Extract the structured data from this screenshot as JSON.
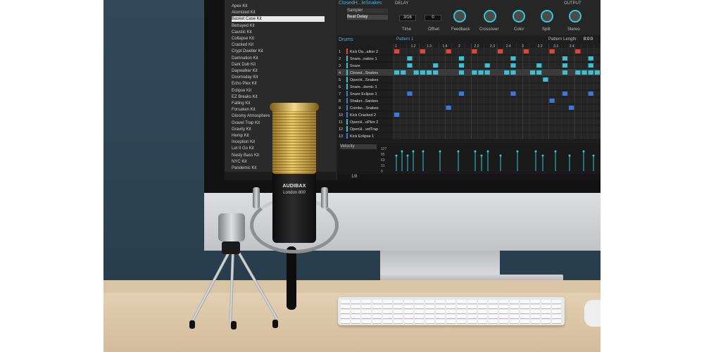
{
  "library": {
    "kits": [
      "Apex Kit",
      "Atomized Kit",
      "Basket Case Kit",
      "Betrayed Kit",
      "Caustic Kit",
      "Collapse Kit",
      "Cracked Kit",
      "Crypt Dweller Kit",
      "Damnation Kit",
      "Dark Dub Kit",
      "Daywalker Kit",
      "Doomsday Kit",
      "Echo Plex Kit",
      "Eclipse Kit",
      "EZ Breaks Kit",
      "Falling Kit",
      "Forsaken Kit",
      "Gloomy Atmosphere",
      "Gravel Trap Kit",
      "Gravity Kit",
      "Hemp Kit",
      "Inception Kit",
      "Let It Go Kit",
      "Nasty Bass Kit",
      "NYC Kit",
      "Pandemic Kit"
    ],
    "selected_index": 2
  },
  "plugin": {
    "sound_name": "ClosedH...leSnakes",
    "slots": [
      "Sampler",
      "Beat Delay"
    ],
    "section": "DELAY",
    "output_label": "OUTPUT",
    "time_value": "3/16",
    "offset_value": "0",
    "knobs": [
      "Time",
      "Offset",
      "Feedback",
      "Crossover",
      "Color",
      "Split",
      "Stereo"
    ]
  },
  "sequencer": {
    "group": "Drums",
    "pattern": "Pattern 1",
    "pattern_length_label": "Pattern Length:",
    "pattern_length_value": "8:0:0",
    "ruler": [
      "1",
      "1.2",
      "1.3",
      "1.4",
      "2",
      "2.2",
      "2.3",
      "2.4",
      "3",
      "3.2",
      "3.3",
      "3.4"
    ],
    "tracks": [
      {
        "n": "1",
        "name": "Kick Da...alker 2",
        "color": "#e0473a"
      },
      {
        "n": "2",
        "name": "Snare...nakes 1",
        "color": "#3cc0d6"
      },
      {
        "n": "3",
        "name": "Snare",
        "color": "#3cc0d6"
      },
      {
        "n": "4",
        "name": "Closed...Snakes",
        "color": "#3cc0d6"
      },
      {
        "n": "5",
        "name": "OpenH...Snakes",
        "color": "#3cc0d6"
      },
      {
        "n": "6",
        "name": "Snare...demic 1",
        "color": "#3cc0d6"
      },
      {
        "n": "7",
        "name": "Snare Eclipse 1",
        "color": "#3f78d6"
      },
      {
        "n": "8",
        "name": "Shaker...Sankes",
        "color": "#3f78d6"
      },
      {
        "n": "9",
        "name": "Combo...Snakes",
        "color": "#3f78d6"
      },
      {
        "n": "10",
        "name": "Kick Cracked 2",
        "color": "#3f78d6"
      },
      {
        "n": "11",
        "name": "OpenH...oPlex 2",
        "color": "#3cc0d6"
      },
      {
        "n": "12",
        "name": "OpenH...velTrap",
        "color": "#3cc0d6"
      },
      {
        "n": "13",
        "name": "Kick Eclipse 1",
        "color": "#3f78d6"
      }
    ],
    "velocity_label": "Velocity",
    "velocity_scale": [
      "127",
      "95",
      "63",
      "31",
      "0"
    ],
    "footer_value": "1/8"
  },
  "microphone": {
    "brand": "AUDIBAX",
    "model": "London 800"
  },
  "colors": {
    "accent": "#35c5d8",
    "kick": "#e0473a",
    "snare": "#3cc0d6",
    "percussion": "#3f78d6",
    "mic_gold": "#e0bd5a"
  }
}
